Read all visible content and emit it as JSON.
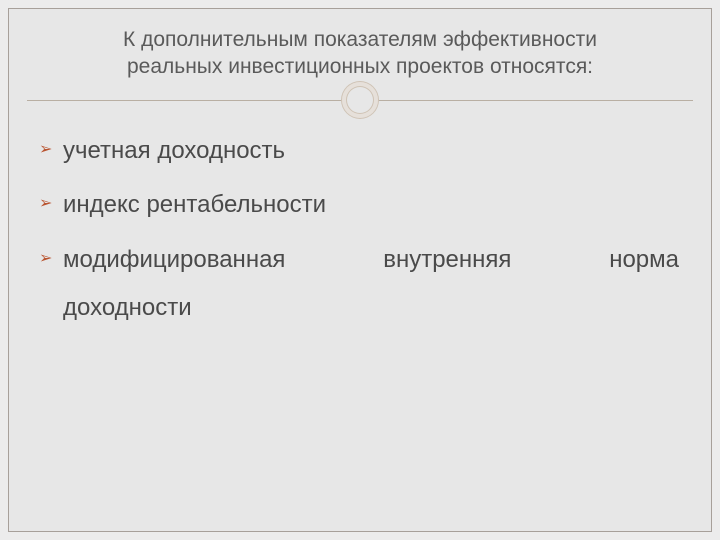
{
  "header": {
    "title_line1": "К дополнительным показателям эффективности",
    "title_line2": "реальных инвестиционных проектов относятся:"
  },
  "bullets": {
    "item1": "учетная доходность",
    "item2": "индекс рентабельности",
    "item3_w1": "модифицированная",
    "item3_w2": "внутренняя",
    "item3_w3": "норма",
    "item3_line2": "доходности"
  }
}
